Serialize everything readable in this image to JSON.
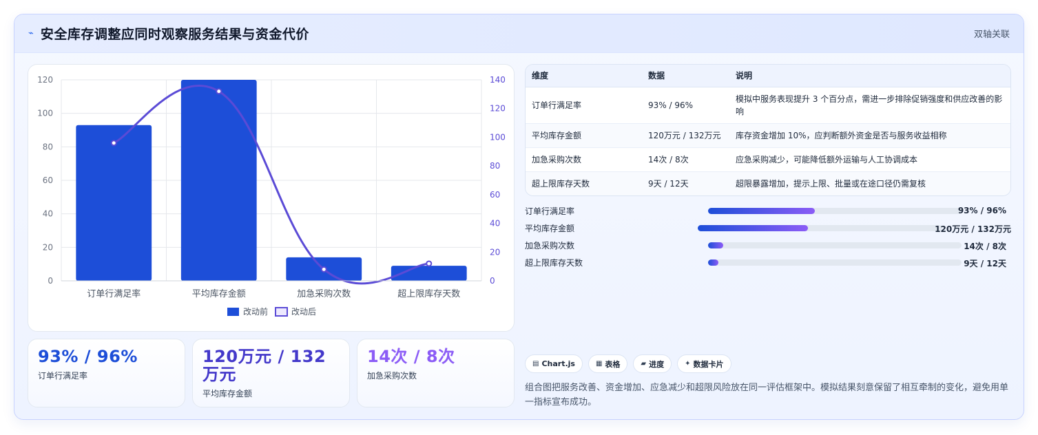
{
  "header": {
    "icon": "bolt-icon",
    "title": "安全库存调整应同时观察服务结果与资金代价",
    "tag": "双轴关联"
  },
  "chart_data": {
    "type": "bar",
    "categories": [
      "订单行满足率",
      "平均库存金额",
      "加急采购次数",
      "超上限库存天数"
    ],
    "series": [
      {
        "name": "改动前",
        "type": "bar",
        "axis": "left",
        "values": [
          93,
          120,
          14,
          9
        ],
        "color": "#1d4ed8"
      },
      {
        "name": "改动后",
        "type": "line",
        "axis": "right",
        "values": [
          96,
          132,
          8,
          12
        ],
        "color": "#5b4bd6"
      }
    ],
    "y_left": {
      "min": 0,
      "max": 120,
      "ticks": [
        0,
        20,
        40,
        60,
        80,
        100,
        120
      ]
    },
    "y_right": {
      "min": 0,
      "max": 140,
      "ticks": [
        0,
        20,
        40,
        60,
        80,
        100,
        120,
        140
      ]
    },
    "grid": true,
    "legend": "bottom"
  },
  "stats": [
    {
      "value": "93% / 96%",
      "label": "订单行满足率",
      "color": "#1d4ed8"
    },
    {
      "value": "120万元 / 132万元",
      "label": "平均库存金额",
      "color": "#4338ca"
    },
    {
      "value": "14次 / 8次",
      "label": "加急采购次数",
      "color": "#8b5cf6"
    }
  ],
  "table": {
    "headers": [
      "维度",
      "数据",
      "说明"
    ],
    "rows": [
      [
        "订单行满足率",
        "93% / 96%",
        "模拟中服务表现提升 3 个百分点，需进一步排除促销强度和供应改善的影响"
      ],
      [
        "平均库存金额",
        "120万元 / 132万元",
        "库存资金增加 10%，应判断额外资金是否与服务收益相称"
      ],
      [
        "加急采购次数",
        "14次 / 8次",
        "应急采购减少，可能降低额外运输与人工协调成本"
      ],
      [
        "超上限库存天数",
        "9天 / 12天",
        "超限暴露增加，提示上限、批量或在途口径仍需复核"
      ]
    ]
  },
  "progress": [
    {
      "name": "订单行满足率",
      "value": "93% / 96%",
      "fraction": 0.42
    },
    {
      "name": "平均库存金额",
      "value": "120万元 / 132万元",
      "fraction": 0.45
    },
    {
      "name": "加急采购次数",
      "value": "14次 / 8次",
      "fraction": 0.06
    },
    {
      "name": "超上限库存天数",
      "value": "9天 / 12天",
      "fraction": 0.04
    }
  ],
  "chips": [
    {
      "icon": "chart-icon",
      "glyph": "▤",
      "label": "Chart.js"
    },
    {
      "icon": "table-icon",
      "glyph": "▦",
      "label": "表格"
    },
    {
      "icon": "progress-icon",
      "glyph": "▰",
      "label": "进度"
    },
    {
      "icon": "sparkle-icon",
      "glyph": "✦",
      "label": "数据卡片"
    }
  ],
  "description": "组合图把服务改善、资金增加、应急减少和超限风险放在同一评估框架中。模拟结果刻意保留了相互牵制的变化，避免用单一指标宣布成功。"
}
